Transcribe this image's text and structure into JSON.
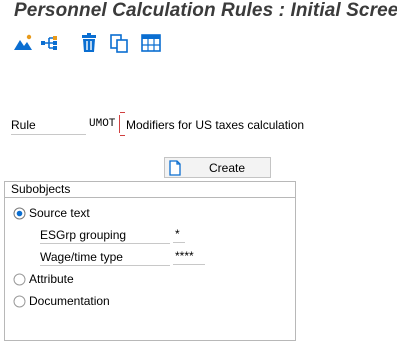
{
  "window": {
    "title": "Personnel Calculation Rules : Initial Screen"
  },
  "toolbar": {
    "buttons": [
      {
        "icon": "mountains-icon",
        "name": "display-mode-button"
      },
      {
        "icon": "hierarchy-icon",
        "name": "structure-button"
      },
      {
        "icon": "trash-icon",
        "name": "delete-button"
      },
      {
        "icon": "copy-icon",
        "name": "copy-button"
      },
      {
        "icon": "table-icon",
        "name": "overview-button"
      }
    ]
  },
  "rule": {
    "label": "Rule",
    "value": "UMOT",
    "description": "Modifiers for US taxes calculation"
  },
  "create": {
    "label": "Create",
    "icon": "document-icon"
  },
  "subobjects": {
    "title": "Subobjects",
    "options": [
      {
        "label": "Source text",
        "selected": true
      },
      {
        "label": "Attribute",
        "selected": false
      },
      {
        "label": "Documentation",
        "selected": false
      }
    ],
    "fields": [
      {
        "label": "ESGrp grouping",
        "value": "*"
      },
      {
        "label": "Wage/time type",
        "value": "****"
      }
    ]
  },
  "colors": {
    "accent": "#0a6ed1",
    "required": "#d04040"
  }
}
